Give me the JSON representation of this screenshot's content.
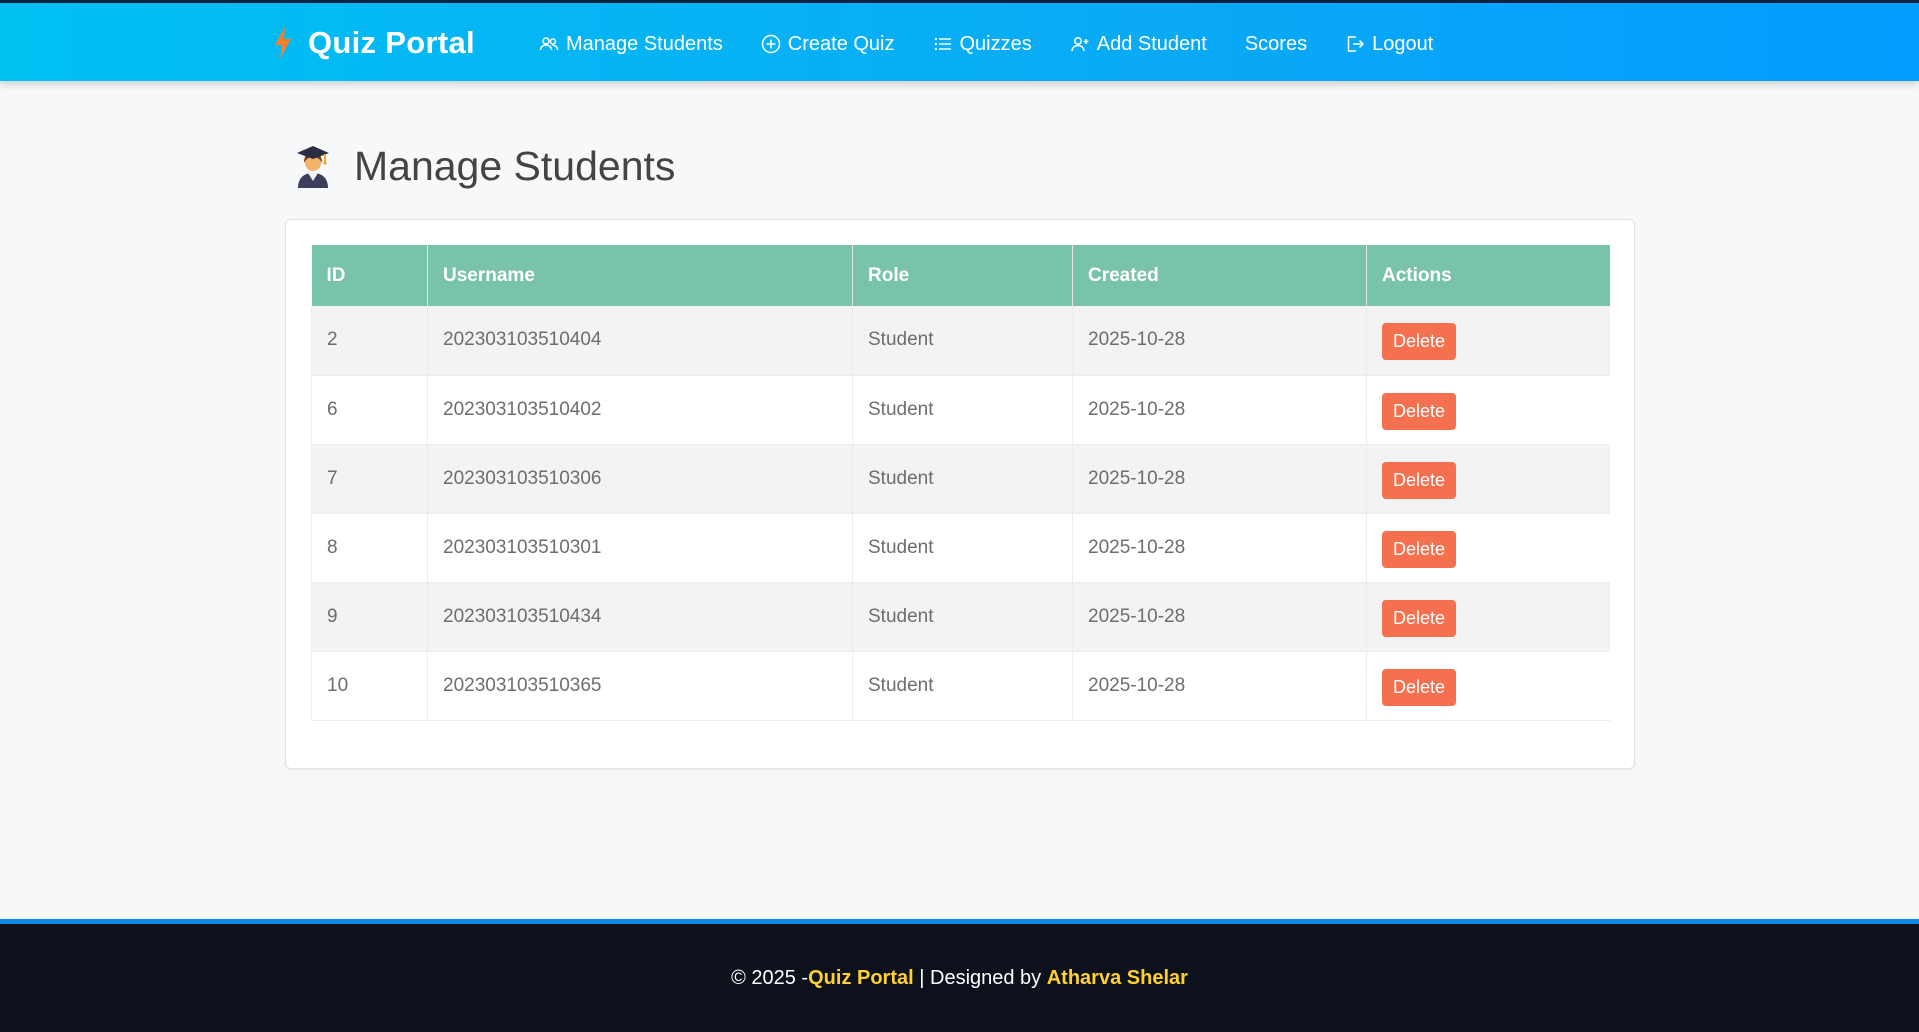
{
  "navbar": {
    "brand": "Quiz Portal",
    "links": [
      {
        "label": "Manage Students",
        "icon": "users-icon"
      },
      {
        "label": "Create Quiz",
        "icon": "plus-circle-icon"
      },
      {
        "label": "Quizzes",
        "icon": "list-icon"
      },
      {
        "label": "Add Student",
        "icon": "user-plus-icon"
      },
      {
        "label": "Scores",
        "icon": ""
      },
      {
        "label": "Logout",
        "icon": "logout-icon"
      }
    ]
  },
  "page": {
    "title": "Manage Students",
    "title_icon": "student-graduate-icon"
  },
  "table": {
    "headers": [
      "ID",
      "Username",
      "Role",
      "Created",
      "Actions"
    ],
    "rows": [
      {
        "id": "2",
        "username": "202303103510404",
        "role": "Student",
        "created": "2025-10-28",
        "action": "Delete"
      },
      {
        "id": "6",
        "username": "202303103510402",
        "role": "Student",
        "created": "2025-10-28",
        "action": "Delete"
      },
      {
        "id": "7",
        "username": "202303103510306",
        "role": "Student",
        "created": "2025-10-28",
        "action": "Delete"
      },
      {
        "id": "8",
        "username": "202303103510301",
        "role": "Student",
        "created": "2025-10-28",
        "action": "Delete"
      },
      {
        "id": "9",
        "username": "202303103510434",
        "role": "Student",
        "created": "2025-10-28",
        "action": "Delete"
      },
      {
        "id": "10",
        "username": "202303103510365",
        "role": "Student",
        "created": "2025-10-28",
        "action": "Delete"
      }
    ]
  },
  "footer": {
    "prefix": "© 2025 - ",
    "brand": "Quiz Portal",
    "middle": " | Designed by ",
    "author": "Atharva Shelar"
  },
  "colors": {
    "navbar_start": "#00c0f2",
    "navbar_end": "#009cff",
    "table_header": "#79c3ac",
    "delete_button": "#f5704f",
    "footer_bg": "#0d111b",
    "footer_highlight": "#ffd02f"
  }
}
